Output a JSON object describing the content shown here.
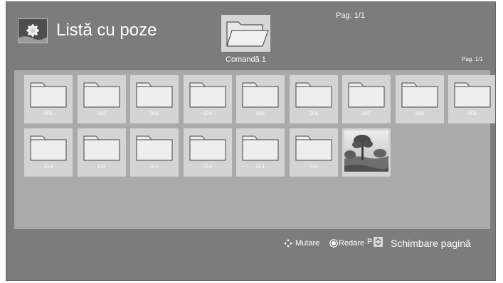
{
  "header": {
    "title": "Listă cu poze",
    "icon": "photo-list-icon",
    "command_label": "Comandă 1",
    "page_top": "Pag. 1/1",
    "page_right": "Pag. 1/1"
  },
  "grid": {
    "folders": [
      {
        "label": "001"
      },
      {
        "label": "002"
      },
      {
        "label": "003"
      },
      {
        "label": "004"
      },
      {
        "label": "005"
      },
      {
        "label": "006"
      },
      {
        "label": "007"
      },
      {
        "label": "008"
      },
      {
        "label": "009"
      },
      {
        "label": "010"
      },
      {
        "label": "011"
      },
      {
        "label": "012"
      },
      {
        "label": "013"
      },
      {
        "label": "014"
      },
      {
        "label": "015"
      }
    ],
    "photo_icon": "landscape-photo-thumbnail"
  },
  "footer": {
    "move_label": "Mutare",
    "move_icon": "arrows-move-icon",
    "play_label": "Redare",
    "play_icon": "ok-button-icon",
    "page_key_label": "P",
    "page_key_icon": "page-updown-icon",
    "change_page_label": "Schimbare pagină"
  },
  "colors": {
    "background": "#7c7c7c",
    "panel": "#aaaaaa",
    "tile": "#d4d4d4",
    "text": "#ffffff"
  }
}
